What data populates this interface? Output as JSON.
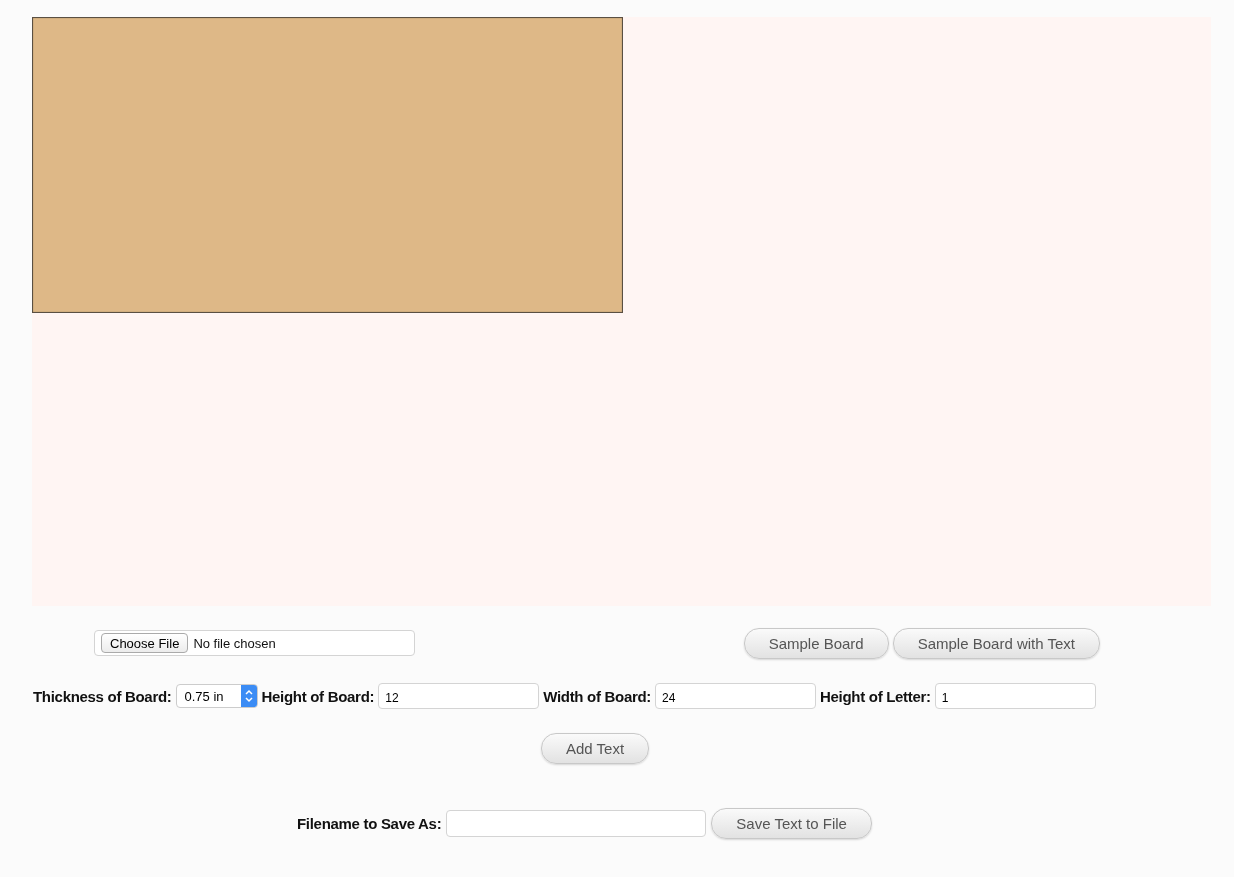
{
  "file_picker": {
    "button": "Choose File",
    "status": "No file chosen"
  },
  "sample_buttons": [
    "Sample Board",
    "Sample Board with Text"
  ],
  "board_fields": [
    {
      "kind": "select",
      "label": "Thickness of Board:",
      "value": "0.75 in"
    },
    {
      "kind": "text",
      "label": "Height of Board:",
      "value": "12"
    },
    {
      "kind": "text",
      "label": "Width of Board:",
      "value": "24"
    },
    {
      "kind": "text",
      "label": "Height of Letter:",
      "value": "1"
    }
  ],
  "add_button": "Add Text",
  "save": {
    "label": "Filename to Save As:",
    "button": "Save Text to File"
  }
}
